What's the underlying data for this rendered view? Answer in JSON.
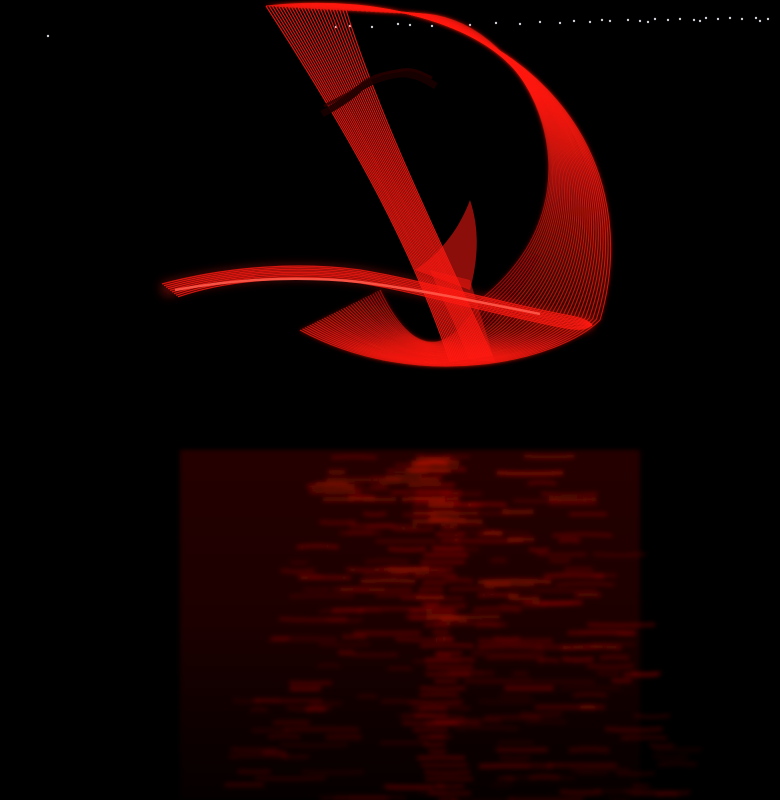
{
  "scene": {
    "subject": "red-light-painting",
    "colors": {
      "background": "#000000",
      "light_trail": "#ff1a12",
      "light_trail_core": "#ff5a4a",
      "reflection": "#d01008",
      "distant_lights": "#f4f4ff"
    }
  }
}
